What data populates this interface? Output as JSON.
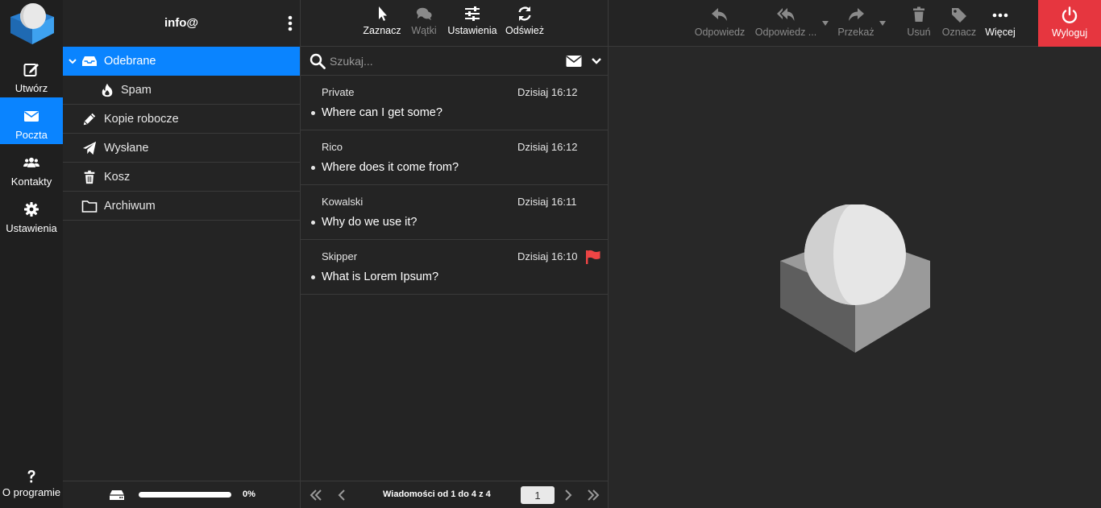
{
  "nav": {
    "items": [
      {
        "label": "Utwórz",
        "icon": "compose-icon"
      },
      {
        "label": "Poczta",
        "icon": "envelope-icon",
        "active": true
      },
      {
        "label": "Kontakty",
        "icon": "contacts-icon"
      },
      {
        "label": "Ustawienia",
        "icon": "gear-icon"
      }
    ],
    "about_label": "O programie"
  },
  "folders": {
    "account": "info@",
    "items": [
      {
        "label": "Odebrane",
        "icon": "inbox-icon",
        "active": true
      },
      {
        "label": "Spam",
        "icon": "fire-icon"
      },
      {
        "label": "Kopie robocze",
        "icon": "pencil-icon"
      },
      {
        "label": "Wysłane",
        "icon": "paper-plane-icon"
      },
      {
        "label": "Kosz",
        "icon": "trash-icon"
      },
      {
        "label": "Archiwum",
        "icon": "folder-icon"
      }
    ],
    "quota_percent": 0,
    "quota_text": "0%"
  },
  "list_toolbar": {
    "select": "Zaznacz",
    "threads": "Wątki",
    "settings": "Ustawienia",
    "refresh": "Odśwież"
  },
  "search": {
    "placeholder": "Szukaj..."
  },
  "messages": [
    {
      "from": "Private",
      "date": "Dzisiaj 16:12",
      "subject": "Where can I get some?",
      "flagged": false
    },
    {
      "from": "Rico",
      "date": "Dzisiaj 16:12",
      "subject": "Where does it come from?",
      "flagged": false
    },
    {
      "from": "Kowalski",
      "date": "Dzisiaj 16:11",
      "subject": "Why do we use it?",
      "flagged": false
    },
    {
      "from": "Skipper",
      "date": "Dzisiaj 16:10",
      "subject": "What is Lorem Ipsum?",
      "flagged": true
    }
  ],
  "pager": {
    "count_text": "Wiadomości od 1 do 4 z 4",
    "page": "1"
  },
  "toolbar": {
    "reply": "Odpowiedz",
    "reply_all": "Odpowiedz ...",
    "forward": "Przekaż",
    "delete": "Usuń",
    "mark": "Oznacz",
    "more": "Więcej",
    "logout": "Wyloguj"
  },
  "colors": {
    "accent": "#0a84ff",
    "logout": "#e6363f",
    "flag": "#f04545"
  }
}
